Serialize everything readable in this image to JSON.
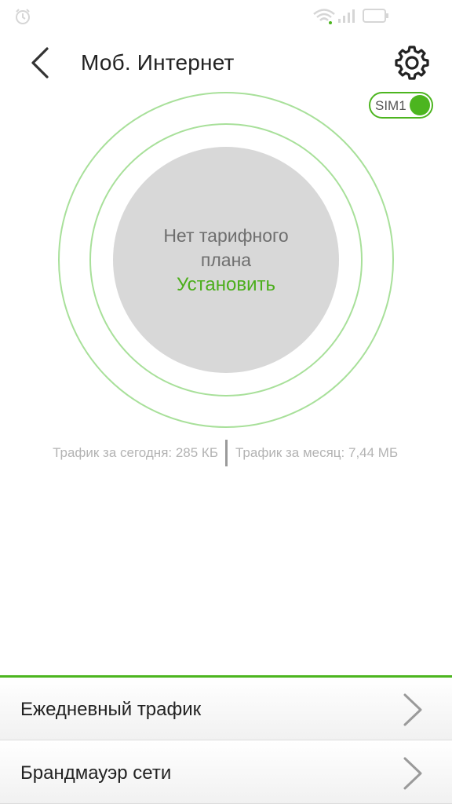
{
  "status_bar": {
    "icons": [
      "alarm-icon",
      "wifi-icon",
      "signal-icon",
      "battery-icon"
    ]
  },
  "header": {
    "title": "Моб. Интернет",
    "back_icon": "chevron-left-icon",
    "settings_icon": "gear-icon"
  },
  "sim": {
    "label": "SIM1",
    "enabled": true
  },
  "plan": {
    "message": "Нет тарифного плана",
    "action": "Установить"
  },
  "traffic": {
    "today": "Трафик за сегодня: 285 КБ",
    "month": "Трафик за месяц: 7,44 МБ"
  },
  "menu": [
    {
      "label": "Ежедневный трафик",
      "icon": "chevron-right-icon"
    },
    {
      "label": "Брандмауэр сети",
      "icon": "chevron-right-icon"
    }
  ],
  "colors": {
    "accent": "#4cb51f",
    "ring": "#a8e09a",
    "disk": "#d8d8d8",
    "text_primary": "#222222",
    "text_muted": "#b3b3b3"
  }
}
